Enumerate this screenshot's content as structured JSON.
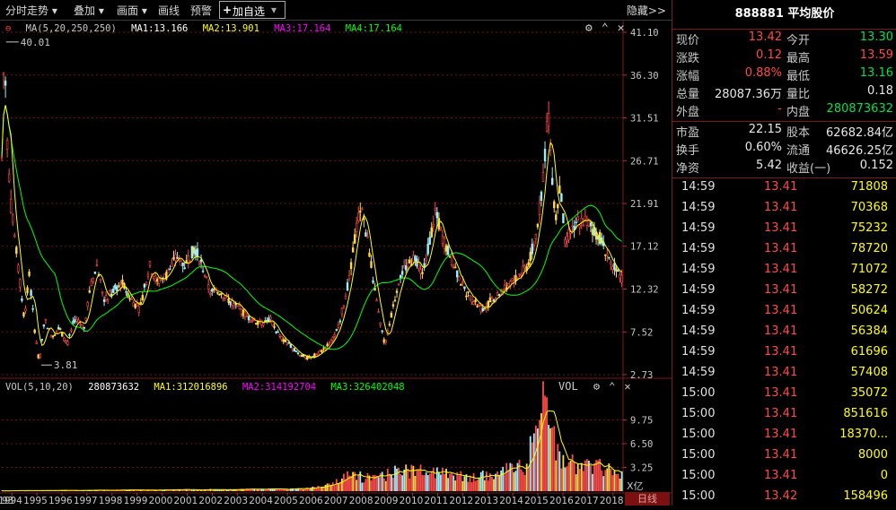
{
  "toolbar": {
    "items": [
      "分时走势",
      "叠加",
      "画面",
      "画线",
      "预警"
    ],
    "add_label": "加自选",
    "hide_label": "隐藏>>"
  },
  "price_panel": {
    "ma_label": "MA(5,20,250,250)",
    "ma1": "MA1:13.166",
    "ma2": "MA2:13.901",
    "ma3": "MA3:17.164",
    "ma4": "MA4:17.164",
    "y_ticks": [
      "41.10",
      "36.30",
      "31.51",
      "26.71",
      "21.91",
      "17.12",
      "12.32",
      "7.52",
      "2.73"
    ],
    "max_marker": "40.01",
    "min_marker": "3.81"
  },
  "volume_panel": {
    "label": "VOL(5,10,20)",
    "current": "280873632",
    "ma1": "MA1:312016896",
    "ma2": "MA2:314192704",
    "ma3": "MA3:326402048",
    "panel_tag": "VOL",
    "y_ticks": [
      "9.75",
      "6.50",
      "3.25"
    ],
    "unit": "X亿"
  },
  "x_axis": {
    "labels": [
      "93",
      "1994",
      "1995",
      "1996",
      "1997",
      "1998",
      "1999",
      "2000",
      "2001",
      "2002",
      "2003",
      "2004",
      "2005",
      "2006",
      "2007",
      "2008",
      "2009",
      "2010",
      "2011",
      "2012",
      "2013",
      "2014",
      "2015",
      "2016",
      "2017",
      "2018"
    ],
    "period_button": "日线"
  },
  "colors": {
    "up": "#ff4a4a",
    "down": "#00e050",
    "ma1": "#ffffff",
    "ma2": "#ffff00",
    "ma3": "#ff00ff",
    "ma4": "#00ff00",
    "volume": "#ffff00"
  },
  "quote": {
    "title": "888881 平均股价",
    "rows": [
      {
        "l1": "现价",
        "v1": "13.42",
        "c1": "red",
        "l2": "今开",
        "v2": "13.30",
        "c2": "green"
      },
      {
        "l1": "涨跌",
        "v1": "0.12",
        "c1": "red",
        "l2": "最高",
        "v2": "13.59",
        "c2": "red"
      },
      {
        "l1": "涨幅",
        "v1": "0.88%",
        "c1": "red",
        "l2": "最低",
        "v2": "13.16",
        "c2": "green"
      },
      {
        "l1": "总量",
        "v1": "28087.36万",
        "c1": "white",
        "l2": "量比",
        "v2": "0.18",
        "c2": "white"
      },
      {
        "l1": "外盘",
        "v1": "-",
        "c1": "red",
        "l2": "内盘",
        "v2": "280873632",
        "c2": "green"
      }
    ],
    "rows2": [
      {
        "l1": "市盈",
        "v1": "22.15",
        "l2": "股本",
        "v2": "62682.84亿"
      },
      {
        "l1": "换手",
        "v1": "0.60%",
        "l2": "流通",
        "v2": "46626.25亿"
      },
      {
        "l1": "净资",
        "v1": "5.42",
        "l2": "收益(一)",
        "v2": "0.152"
      }
    ]
  },
  "ticks": [
    {
      "time": "14:59",
      "price": "13.41",
      "vol": "71808"
    },
    {
      "time": "14:59",
      "price": "13.41",
      "vol": "70368"
    },
    {
      "time": "14:59",
      "price": "13.41",
      "vol": "75232"
    },
    {
      "time": "14:59",
      "price": "13.41",
      "vol": "78720"
    },
    {
      "time": "14:59",
      "price": "13.41",
      "vol": "71072"
    },
    {
      "time": "14:59",
      "price": "13.41",
      "vol": "58272"
    },
    {
      "time": "14:59",
      "price": "13.41",
      "vol": "50624"
    },
    {
      "time": "14:59",
      "price": "13.41",
      "vol": "56384"
    },
    {
      "time": "14:59",
      "price": "13.41",
      "vol": "61696"
    },
    {
      "time": "14:59",
      "price": "13.41",
      "vol": "57408"
    },
    {
      "time": "15:00",
      "price": "13.41",
      "vol": "35072"
    },
    {
      "time": "15:00",
      "price": "13.41",
      "vol": "851616"
    },
    {
      "time": "15:00",
      "price": "13.41",
      "vol": "18370..."
    },
    {
      "time": "15:00",
      "price": "13.41",
      "vol": "8000"
    },
    {
      "time": "15:00",
      "price": "13.41",
      "vol": "0"
    },
    {
      "time": "15:00",
      "price": "13.42",
      "vol": "158496"
    }
  ]
}
